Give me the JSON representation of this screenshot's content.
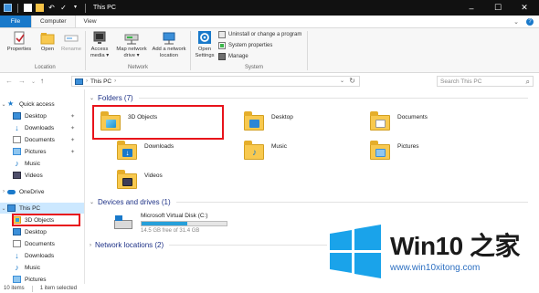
{
  "window": {
    "title": "This PC",
    "controls": {
      "minimize": "–",
      "maximize": "☐",
      "close": "✕"
    }
  },
  "ribbon_tabs": {
    "file": "File",
    "computer": "Computer",
    "view": "View",
    "right_icons": [
      "chevron-down-icon",
      "help-icon"
    ]
  },
  "ribbon": {
    "location": {
      "label": "Location",
      "properties": "Properties",
      "open": "Open",
      "rename": "Rename"
    },
    "network": {
      "label": "Network",
      "access_media": "Access media ▾",
      "map_drive": "Map network drive ▾",
      "add_location": "Add a network location"
    },
    "system": {
      "label": "System",
      "open_settings": "Open Settings",
      "uninstall": "Uninstall or change a program",
      "system_properties": "System properties",
      "manage": "Manage"
    }
  },
  "addressbar": {
    "path": "This PC",
    "search_placeholder": "Search This PC"
  },
  "nav": {
    "quick_access": "Quick access",
    "items": [
      {
        "label": "Desktop",
        "icon": "desktop-icon",
        "pinned": true
      },
      {
        "label": "Downloads",
        "icon": "downloads-icon",
        "pinned": true
      },
      {
        "label": "Documents",
        "icon": "documents-icon",
        "pinned": true
      },
      {
        "label": "Pictures",
        "icon": "pictures-icon",
        "pinned": true
      },
      {
        "label": "Music",
        "icon": "music-icon",
        "pinned": false
      },
      {
        "label": "Videos",
        "icon": "videos-icon",
        "pinned": false
      }
    ],
    "onedrive": "OneDrive",
    "this_pc": "This PC",
    "pc_items": [
      {
        "label": "3D Objects",
        "icon": "3d-objects-icon"
      },
      {
        "label": "Desktop",
        "icon": "desktop-icon"
      },
      {
        "label": "Documents",
        "icon": "documents-icon"
      },
      {
        "label": "Downloads",
        "icon": "downloads-icon"
      },
      {
        "label": "Music",
        "icon": "music-icon"
      },
      {
        "label": "Pictures",
        "icon": "pictures-icon"
      }
    ]
  },
  "content": {
    "folders_header": "Folders (7)",
    "folders": [
      {
        "label": "3D Objects",
        "icon": "3d-objects-icon"
      },
      {
        "label": "Desktop",
        "icon": "desktop-icon"
      },
      {
        "label": "Documents",
        "icon": "documents-icon"
      },
      {
        "label": "Downloads",
        "icon": "downloads-icon"
      },
      {
        "label": "Music",
        "icon": "music-icon"
      },
      {
        "label": "Pictures",
        "icon": "pictures-icon"
      },
      {
        "label": "Videos",
        "icon": "videos-icon"
      }
    ],
    "devices_header": "Devices and drives (1)",
    "drive": {
      "label": "Microsoft Virtual Disk (C:)",
      "free": "14.5 GB free of 31.4 GB",
      "used_fraction": 0.54
    },
    "network_header": "Network locations (2)"
  },
  "statusbar": {
    "items": "10 items",
    "selected": "1 item selected"
  },
  "watermark": {
    "title": "Win10 之家",
    "url": "www.win10xitong.com"
  },
  "colors": {
    "accent": "#1979ca",
    "highlight": "#e8131b",
    "selection": "#cce8ff",
    "header_text": "#1e3287"
  }
}
